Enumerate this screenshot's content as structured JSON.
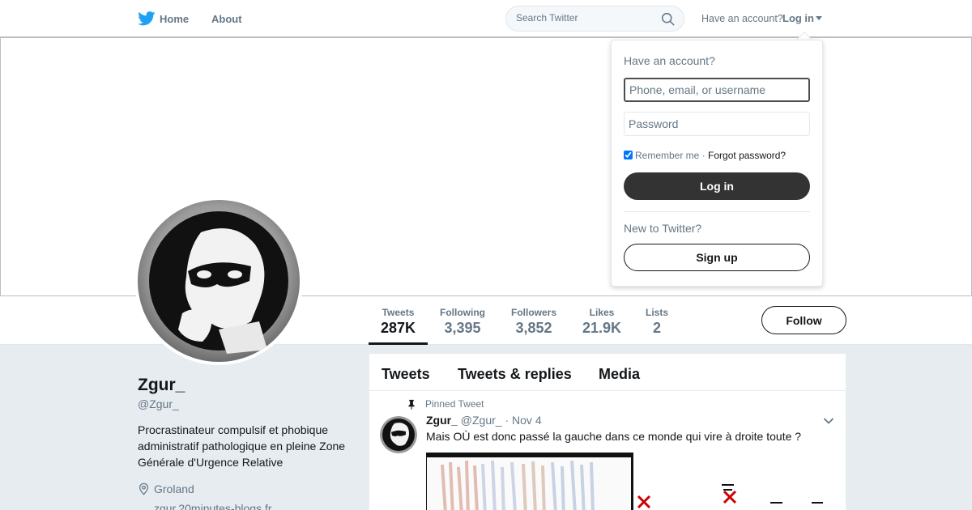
{
  "nav": {
    "home_label": "Home",
    "about_label": "About",
    "search_placeholder": "Search Twitter",
    "have_account": "Have an account?",
    "login_label": "Log in"
  },
  "profile": {
    "name": "Zgur_",
    "handle": "@Zgur_",
    "bio": "Procrastinateur compulsif et phobique administratif pathologique en pleine Zone Générale d'Urgence Relative",
    "location": "Groland",
    "url": "zgur.20minutes-blogs.fr"
  },
  "stats": [
    {
      "label": "Tweets",
      "value": "287K"
    },
    {
      "label": "Following",
      "value": "3,395"
    },
    {
      "label": "Followers",
      "value": "3,852"
    },
    {
      "label": "Likes",
      "value": "21.9K"
    },
    {
      "label": "Lists",
      "value": "2"
    }
  ],
  "follow_label": "Follow",
  "timeline": {
    "tabs": [
      "Tweets",
      "Tweets & replies",
      "Media"
    ],
    "pinned_label": "Pinned Tweet",
    "tweet": {
      "name": "Zgur_",
      "handle": "@Zgur_",
      "separator": "·",
      "date": "Nov 4",
      "text": "Mais OÙ est donc passé la gauche dans ce monde qui vire à droite toute ?"
    }
  },
  "login_dropdown": {
    "title": "Have an account?",
    "username_placeholder": "Phone, email, or username",
    "password_placeholder": "Password",
    "remember_label": "Remember me",
    "dot": "·",
    "forgot_label": "Forgot password?",
    "login_button": "Log in",
    "new_label": "New to Twitter?",
    "signup_button": "Sign up"
  },
  "colors": {
    "brand_blue": "#1da1f2",
    "text_primary": "#14171a",
    "text_secondary": "#657786",
    "page_bg": "#e6ecf0",
    "dark_button": "#333333"
  },
  "icons": {
    "brand": "twitter-bird-icon",
    "search": "search-icon",
    "location": "location-pin-icon",
    "pin": "pushpin-icon",
    "more": "chevron-down-icon"
  }
}
